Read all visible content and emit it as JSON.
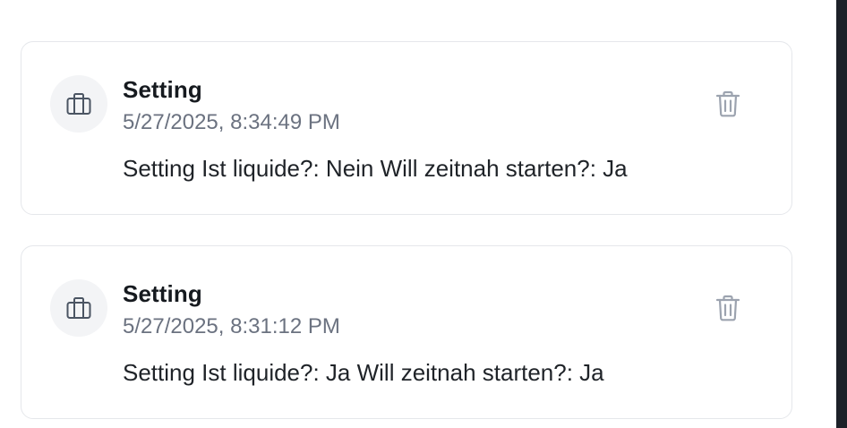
{
  "entries": [
    {
      "icon": "briefcase-icon",
      "title": "Setting",
      "timestamp": "5/27/2025, 8:34:49 PM",
      "text": "Setting Ist liquide?: Nein Will zeitnah starten?: Ja",
      "delete_icon": "trash-icon"
    },
    {
      "icon": "briefcase-icon",
      "title": "Setting",
      "timestamp": "5/27/2025, 8:31:12 PM",
      "text": "Setting Ist liquide?: Ja Will zeitnah starten?: Ja",
      "delete_icon": "trash-icon"
    }
  ],
  "colors": {
    "card_border": "#e5e7eb",
    "avatar_bg": "#f3f4f6",
    "icon_stroke": "#4b5563",
    "trash_stroke": "#9ca3af",
    "muted_text": "#6b7280",
    "right_strip": "#1d2128"
  }
}
